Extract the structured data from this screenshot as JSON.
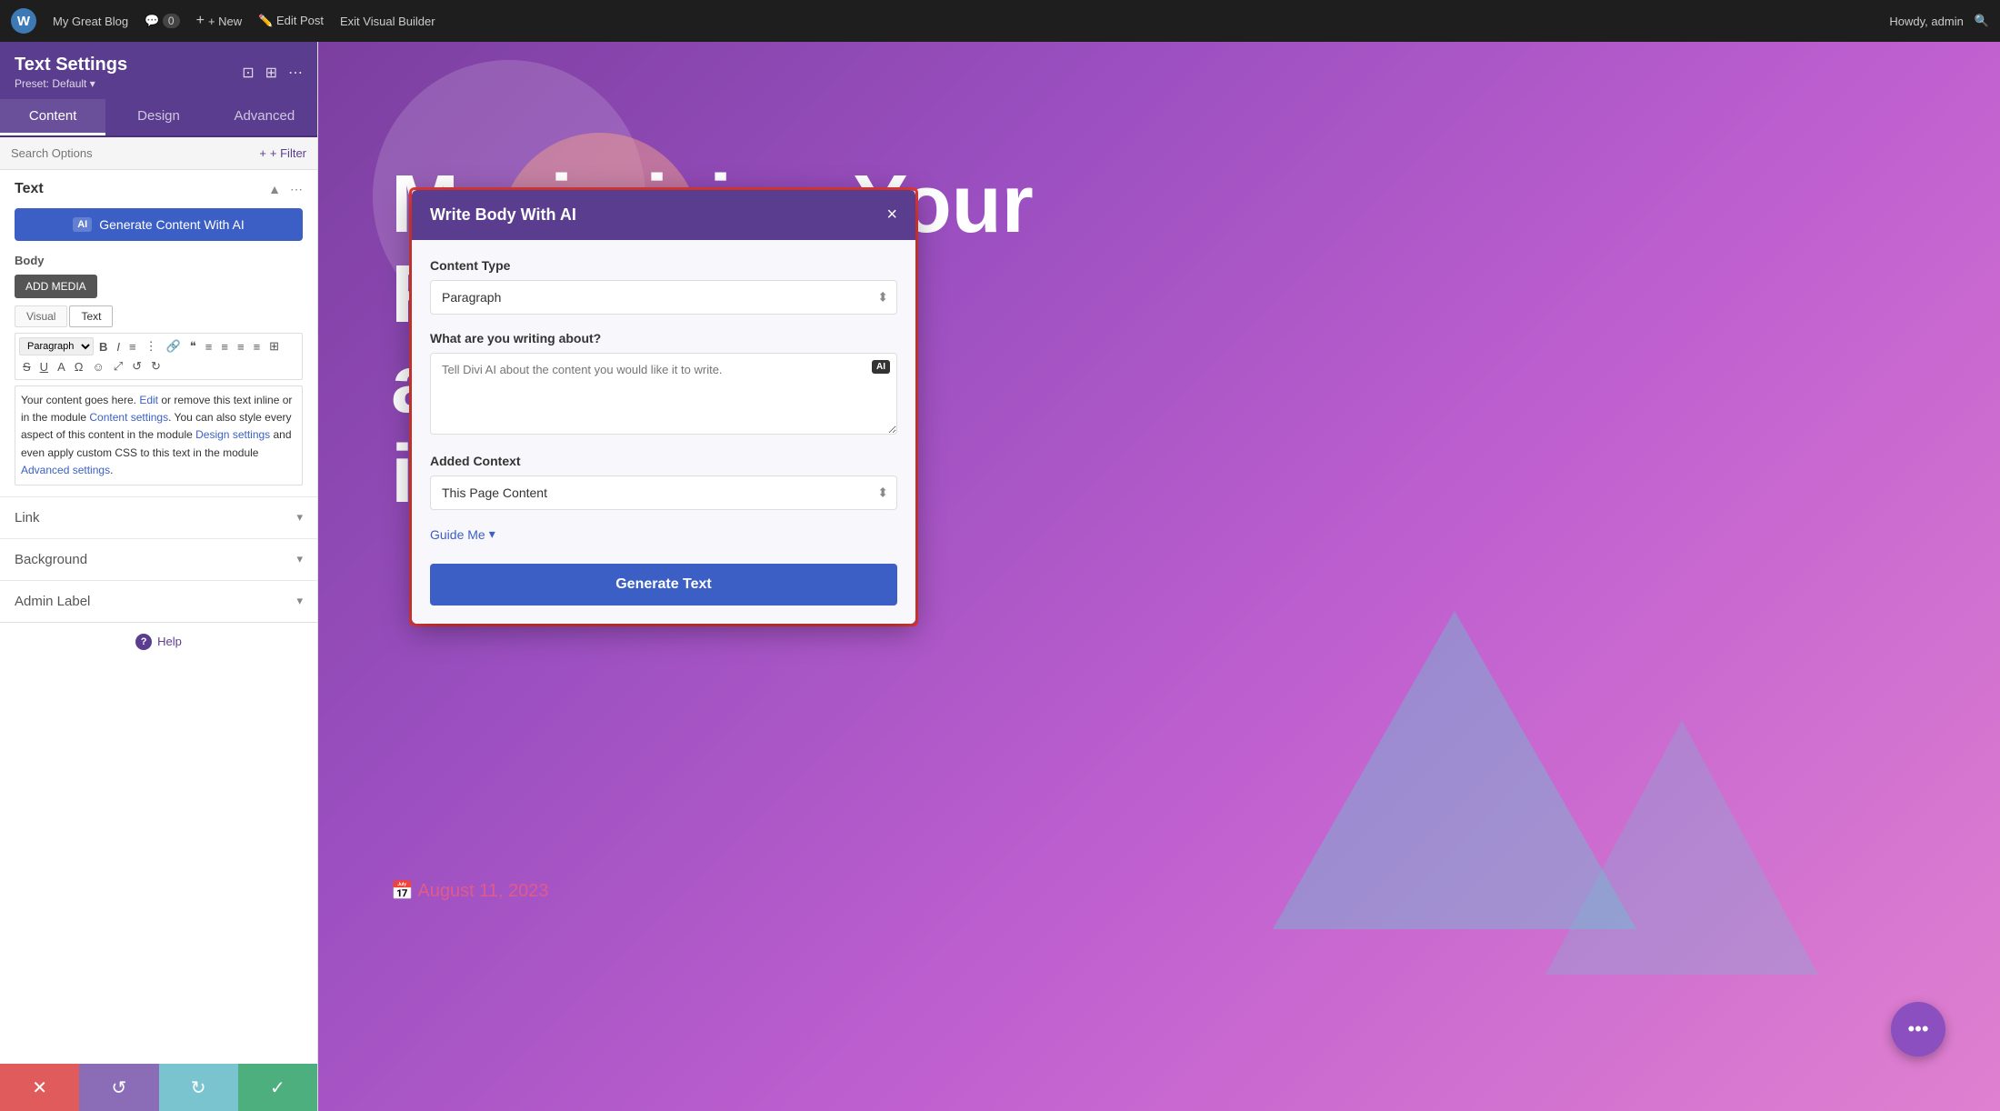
{
  "wp_bar": {
    "logo": "W",
    "site_name": "My Great Blog",
    "comments": "0",
    "new_label": "+ New",
    "edit_post": "Edit Post",
    "exit_builder": "Exit Visual Builder",
    "howdy": "Howdy, admin",
    "search_icon": "🔍"
  },
  "sidebar": {
    "title": "Text Settings",
    "preset": "Preset: Default ▾",
    "tab_content": "Content",
    "tab_design": "Design",
    "tab_advanced": "Advanced",
    "search_placeholder": "Search Options",
    "filter_label": "+ Filter",
    "text_section_title": "Text",
    "ai_button_label": "Generate Content With AI",
    "ai_badge": "AI",
    "body_label": "Body",
    "add_media_label": "ADD MEDIA",
    "editor_tab_visual": "Visual",
    "editor_tab_text": "Text",
    "paragraph_select": "Paragraph",
    "editor_content": "Your content goes here. Edit or remove this text inline or in the module Content settings. You can also style every aspect of this content in the module Design settings and even apply custom CSS to this text in the module Advanced settings.",
    "link_section": "Link",
    "background_section": "Background",
    "admin_label_section": "Admin Label",
    "help_label": "Help",
    "action_cancel": "✕",
    "action_undo": "↺",
    "action_redo": "↻",
    "action_save": "✓"
  },
  "modal": {
    "title": "Write Body With AI",
    "close_icon": "×",
    "content_type_label": "Content Type",
    "content_type_value": "Paragraph",
    "writing_about_label": "What are you writing about?",
    "textarea_placeholder": "Tell Divi AI about the content you would like it to write.",
    "ai_badge": "AI",
    "added_context_label": "Added Context",
    "added_context_value": "This Page Content",
    "guide_me_label": "Guide Me",
    "guide_chevron": "▾",
    "generate_btn_label": "Generate Text"
  },
  "main_content": {
    "heading_line1": "Maximizing Your Reach:",
    "heading_line2": "al Media",
    "heading_line3": "ies for 2023",
    "date": "August 11, 2023",
    "fab_icon": "•••"
  }
}
